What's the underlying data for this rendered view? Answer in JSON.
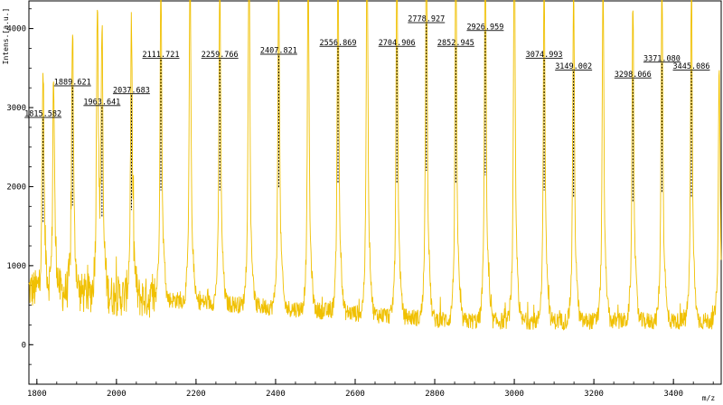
{
  "chart_data": {
    "type": "line",
    "title": "",
    "xlabel": "m/z",
    "ylabel": "Intens.[a.u.]",
    "xlim": [
      1780,
      3520
    ],
    "ylim": [
      -500,
      4350
    ],
    "x_ticks": [
      "1800",
      "2000",
      "2200",
      "2400",
      "2600",
      "2800",
      "3000",
      "3200",
      "3400"
    ],
    "y_ticks": [
      "0",
      "1000",
      "2000",
      "3000",
      "4000"
    ],
    "grid": false,
    "colors": {
      "series": "#f0c000",
      "frame": "#000000",
      "annotation_line": "#000000",
      "background": "#ffffff"
    },
    "series": [
      {
        "values_description": "mass spectrum",
        "baseline_start": 700,
        "baseline_end": 300,
        "peaks": [
          {
            "x": 1815.58,
            "y": 2800
          },
          {
            "x": 1842.0,
            "y": 2700
          },
          {
            "x": 1889.62,
            "y": 3200
          },
          {
            "x": 1952.0,
            "y": 3450
          },
          {
            "x": 1963.64,
            "y": 2950
          },
          {
            "x": 2037.68,
            "y": 3100
          },
          {
            "x": 2111.72,
            "y": 3550
          },
          {
            "x": 2185.0,
            "y": 3650
          },
          {
            "x": 2259.77,
            "y": 3550
          },
          {
            "x": 2333.0,
            "y": 3800
          },
          {
            "x": 2407.82,
            "y": 3600
          },
          {
            "x": 2482.0,
            "y": 3650
          },
          {
            "x": 2556.87,
            "y": 3700
          },
          {
            "x": 2630.0,
            "y": 3900
          },
          {
            "x": 2704.91,
            "y": 3700
          },
          {
            "x": 2778.93,
            "y": 4000
          },
          {
            "x": 2852.95,
            "y": 3700
          },
          {
            "x": 2926.96,
            "y": 3900
          },
          {
            "x": 3000.0,
            "y": 4000
          },
          {
            "x": 3074.99,
            "y": 3550
          },
          {
            "x": 3149.0,
            "y": 3400
          },
          {
            "x": 3223.0,
            "y": 3450
          },
          {
            "x": 3298.07,
            "y": 3300
          },
          {
            "x": 3371.08,
            "y": 3500
          },
          {
            "x": 3445.09,
            "y": 3400
          },
          {
            "x": 3515.0,
            "y": 2600
          }
        ]
      }
    ],
    "annotations": [
      {
        "label": "1815.582",
        "x": 1815.58,
        "y": 2800
      },
      {
        "label": "1889.621",
        "x": 1889.62,
        "y": 3200
      },
      {
        "label": "1963.641",
        "x": 1963.64,
        "y": 2950
      },
      {
        "label": "2037.683",
        "x": 2037.68,
        "y": 3100
      },
      {
        "label": "2111.721",
        "x": 2111.72,
        "y": 3550
      },
      {
        "label": "2259.766",
        "x": 2259.77,
        "y": 3550
      },
      {
        "label": "2407.821",
        "x": 2407.82,
        "y": 3600
      },
      {
        "label": "2556.869",
        "x": 2556.87,
        "y": 3700
      },
      {
        "label": "2704.906",
        "x": 2704.91,
        "y": 3700
      },
      {
        "label": "2778.927",
        "x": 2778.93,
        "y": 4000
      },
      {
        "label": "2852.945",
        "x": 2852.95,
        "y": 3700
      },
      {
        "label": "2926.959",
        "x": 2926.96,
        "y": 3900
      },
      {
        "label": "3074.993",
        "x": 3074.99,
        "y": 3550
      },
      {
        "label": "3149.002",
        "x": 3149.0,
        "y": 3400
      },
      {
        "label": "3298.066",
        "x": 3298.07,
        "y": 3300
      },
      {
        "label": "3371.080",
        "x": 3371.08,
        "y": 3500
      },
      {
        "label": "3445.086",
        "x": 3445.09,
        "y": 3400
      }
    ]
  }
}
